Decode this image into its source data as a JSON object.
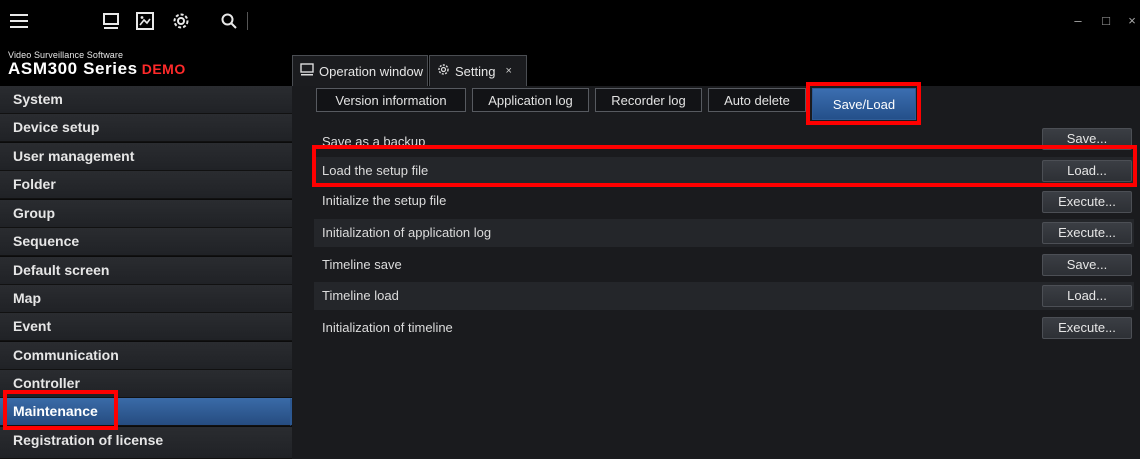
{
  "toolbar": {
    "icons": [
      "menu-icon",
      "monitor-icon",
      "image-icon",
      "gear-icon",
      "search-icon"
    ],
    "window_controls": {
      "minimize": "–",
      "maximize": "□",
      "close": "×"
    }
  },
  "brand": {
    "subtitle": "Video Surveillance Software",
    "title": "ASM300 Series",
    "badge": "DEMO"
  },
  "outer_tabs": [
    {
      "label": "Operation window",
      "icon": "monitor-icon"
    },
    {
      "label": "Setting",
      "icon": "gear-icon",
      "close": "×"
    }
  ],
  "sidebar": {
    "items": [
      {
        "label": "System"
      },
      {
        "label": "Device setup"
      },
      {
        "label": "User management"
      },
      {
        "label": "Folder"
      },
      {
        "label": "Group"
      },
      {
        "label": "Sequence"
      },
      {
        "label": "Default screen"
      },
      {
        "label": "Map"
      },
      {
        "label": "Event"
      },
      {
        "label": "Communication"
      },
      {
        "label": "Controller"
      },
      {
        "label": "Maintenance"
      },
      {
        "label": "Registration of license"
      }
    ],
    "active": "Maintenance"
  },
  "sub_tabs": [
    {
      "label": "Version information"
    },
    {
      "label": "Application log"
    },
    {
      "label": "Recorder log"
    },
    {
      "label": "Auto delete"
    },
    {
      "label": "Save/Load"
    }
  ],
  "active_sub_tab": "Save/Load",
  "rows": [
    {
      "label": "Save as a backup",
      "button": "Save..."
    },
    {
      "label": "Load the setup file",
      "button": "Load..."
    },
    {
      "label": "Initialize the setup file",
      "button": "Execute..."
    },
    {
      "label": "Initialization of application log",
      "button": "Execute..."
    },
    {
      "label": "Timeline save",
      "button": "Save..."
    },
    {
      "label": "Timeline load",
      "button": "Load..."
    },
    {
      "label": "Initialization of timeline",
      "button": "Execute..."
    }
  ],
  "colors": {
    "highlight": "#ff0000",
    "accent": "#2c5892",
    "demo": "#ff2a2a"
  }
}
